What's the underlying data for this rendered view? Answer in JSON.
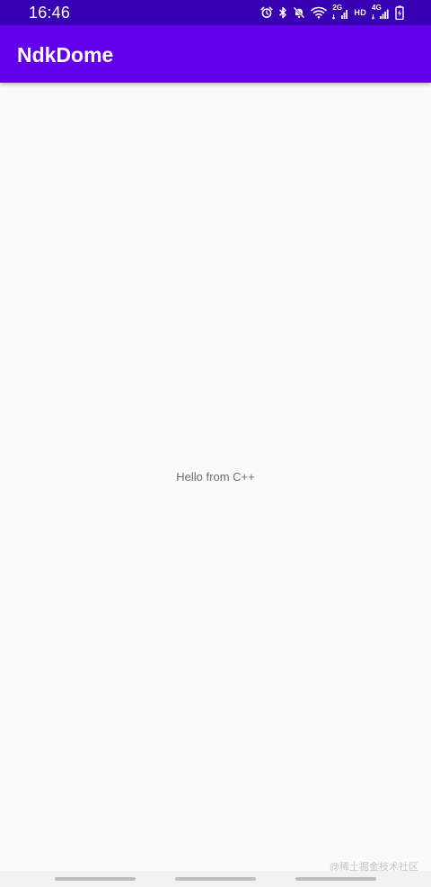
{
  "status_bar": {
    "time": "16:46",
    "icons": [
      "alarm-icon",
      "bluetooth-icon",
      "mute-icon",
      "wifi-icon",
      "signal-2g-icon",
      "hd-icon",
      "signal-4g-icon",
      "battery-charging-icon"
    ],
    "network_2g": "2G",
    "hd": "HD",
    "network_4g": "4G",
    "colors": {
      "background": "#3700B3",
      "text": "#FFFFFF"
    }
  },
  "app_bar": {
    "title": "NdkDome",
    "colors": {
      "background": "#6200EE",
      "text": "#FFFFFF"
    }
  },
  "content": {
    "message": "Hello from C++",
    "colors": {
      "background": "#FAFAFA",
      "text": "#6E6E6E"
    }
  },
  "navigation_bar": {
    "buttons": [
      "recent-apps",
      "home",
      "back"
    ]
  },
  "watermark": {
    "text": "@稀土掘金技术社区"
  }
}
